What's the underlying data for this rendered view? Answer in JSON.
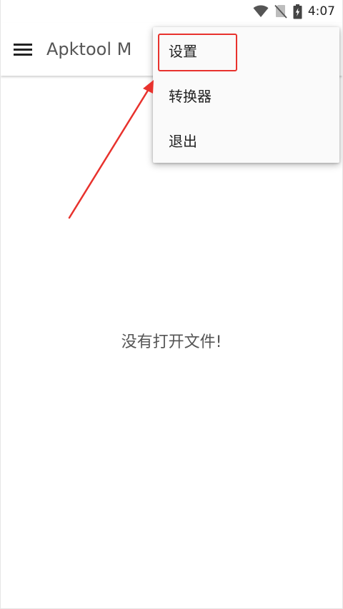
{
  "status_bar": {
    "time": "4:07",
    "icons": [
      "wifi-icon",
      "no-sim-icon",
      "battery-charging-icon"
    ]
  },
  "app_bar": {
    "title": "Apktool M",
    "menu_icon": "hamburger-menu-icon"
  },
  "main": {
    "empty_message": "没有打开文件!"
  },
  "overflow_menu": {
    "items": [
      {
        "label": "设置"
      },
      {
        "label": "转换器"
      },
      {
        "label": "退出"
      }
    ]
  },
  "annotation": {
    "highlight_color": "#e8322d",
    "arrow_color": "#e8322d"
  }
}
